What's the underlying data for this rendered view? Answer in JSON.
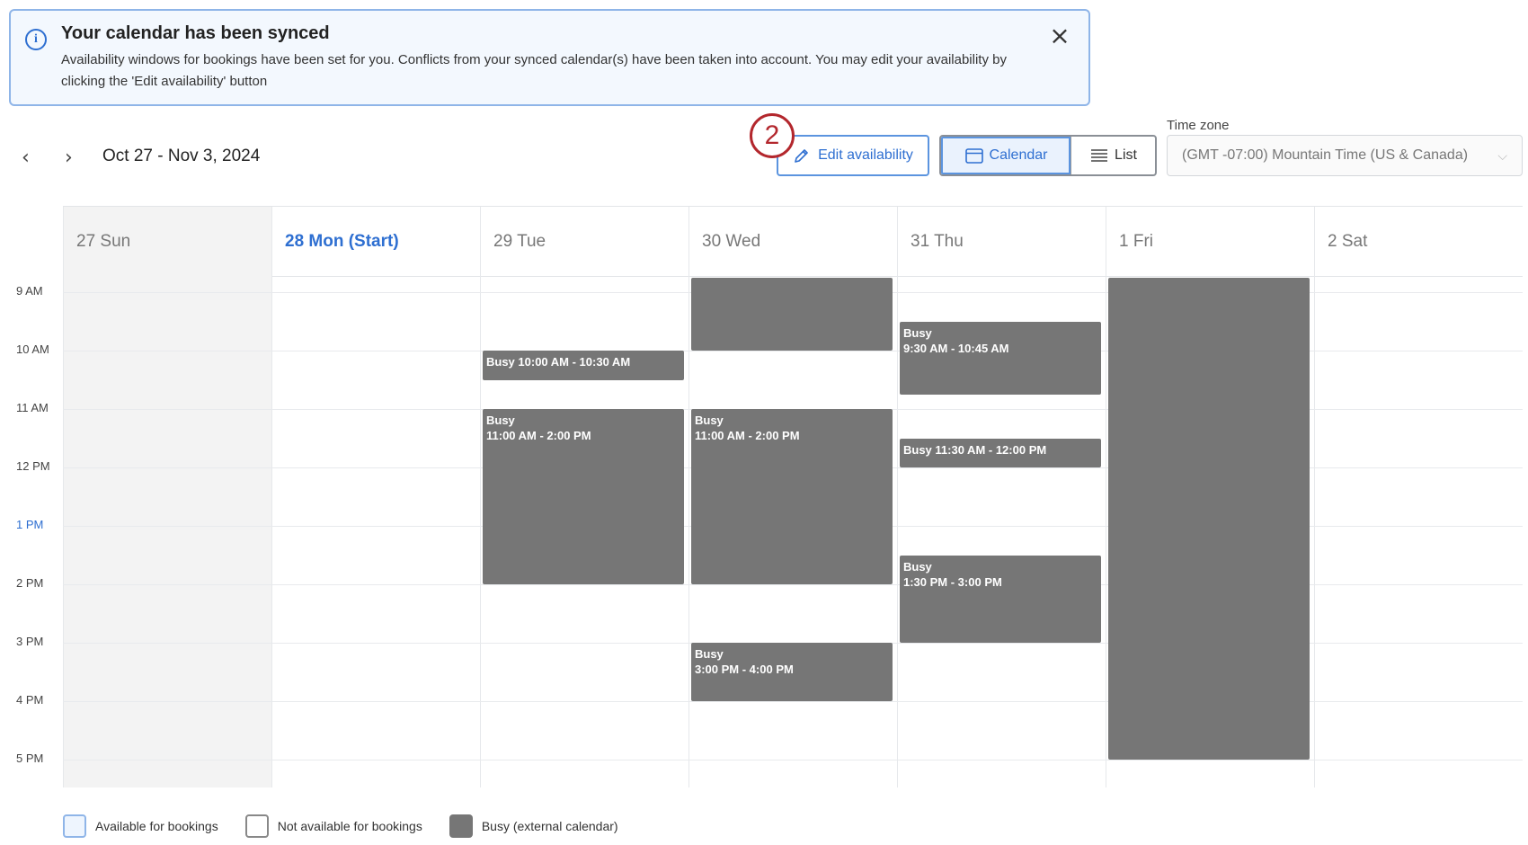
{
  "banner": {
    "title": "Your calendar has been synced",
    "message": "Availability windows for bookings have been set for you. Conflicts from your synced calendar(s) have been taken into account. You may edit your availability by clicking the 'Edit availability' button",
    "icon": "info-icon",
    "close_icon": "close-icon"
  },
  "toolbar": {
    "prev_icon": "chevron-left-icon",
    "next_icon": "chevron-right-icon",
    "date_range": "Oct 27 - Nov 3, 2024",
    "step_badge": "2",
    "edit_label": "Edit availability",
    "calendar_label": "Calendar",
    "list_label": "List",
    "timezone_label": "Time zone",
    "timezone_value": "(GMT -07:00) Mountain Time (US & Canada)"
  },
  "days": [
    {
      "label": "27 Sun"
    },
    {
      "label": "28 Mon (Start)"
    },
    {
      "label": "29 Tue"
    },
    {
      "label": "30 Wed"
    },
    {
      "label": "31 Thu"
    },
    {
      "label": "1 Fri"
    },
    {
      "label": "2 Sat"
    }
  ],
  "hours": [
    "9 AM",
    "10 AM",
    "11 AM",
    "12 PM",
    "1 PM",
    "2 PM",
    "3 PM",
    "4 PM",
    "5 PM"
  ],
  "current_hour": "1 PM",
  "events": [
    {
      "day": 2,
      "start": 10.0,
      "end": 10.5,
      "label": "Busy 10:00 AM - 10:30 AM"
    },
    {
      "day": 2,
      "start": 11.0,
      "end": 14.0,
      "label": "Busy",
      "time": "11:00 AM - 2:00 PM"
    },
    {
      "day": 3,
      "start": 8.75,
      "end": 10.0,
      "label": ""
    },
    {
      "day": 3,
      "start": 11.0,
      "end": 14.0,
      "label": "Busy",
      "time": "11:00 AM - 2:00 PM"
    },
    {
      "day": 3,
      "start": 15.0,
      "end": 16.0,
      "label": "Busy",
      "time": "3:00 PM - 4:00 PM"
    },
    {
      "day": 4,
      "start": 9.5,
      "end": 10.75,
      "label": "Busy",
      "time": "9:30 AM - 10:45 AM"
    },
    {
      "day": 4,
      "start": 11.5,
      "end": 12.0,
      "label": "Busy 11:30 AM - 12:00 PM"
    },
    {
      "day": 4,
      "start": 13.5,
      "end": 15.0,
      "label": "Busy",
      "time": "1:30 PM - 3:00 PM"
    },
    {
      "day": 5,
      "start": 8.75,
      "end": 17.0,
      "label": ""
    }
  ],
  "legend": [
    {
      "label": "Available for bookings",
      "type": "avail"
    },
    {
      "label": "Not available for bookings",
      "type": "notavail"
    },
    {
      "label": "Busy (external calendar)",
      "type": "busy"
    }
  ],
  "colors": {
    "accent": "#2e6fd1",
    "busy": "#767676",
    "step_badge": "#b3272d"
  }
}
